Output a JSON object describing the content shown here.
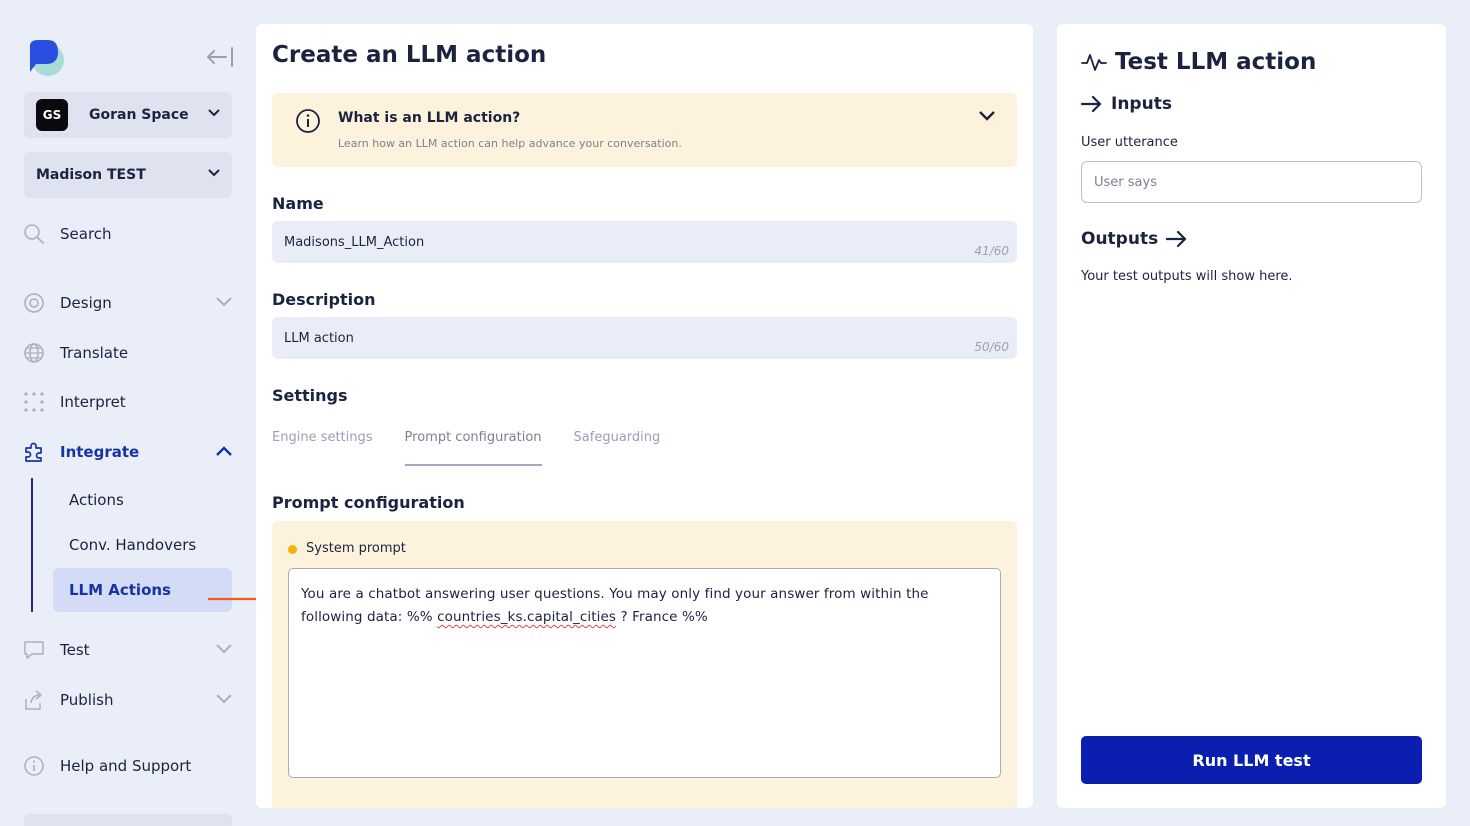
{
  "sidebar": {
    "workspace": {
      "badge": "GS",
      "name": "Goran Space"
    },
    "project": {
      "name": "Madison TEST"
    },
    "nav": {
      "search": "Search",
      "design": "Design",
      "translate": "Translate",
      "interpret": "Interpret",
      "integrate": "Integrate",
      "test": "Test",
      "publish": "Publish",
      "help": "Help and Support"
    },
    "integrate_items": [
      "Actions",
      "Conv. Handovers",
      "LLM Actions"
    ],
    "active_item": "LLM Actions"
  },
  "main": {
    "title": "Create an LLM action",
    "info": {
      "title": "What is an LLM action?",
      "subtitle": "Learn how an LLM action can help advance your conversation."
    },
    "name": {
      "label": "Name",
      "value": "Madisons_LLM_Action",
      "counter": "41/60"
    },
    "description": {
      "label": "Description",
      "value": "LLM action",
      "counter": "50/60"
    },
    "settings": {
      "label": "Settings",
      "tabs": [
        "Engine settings",
        "Prompt configuration",
        "Safeguarding"
      ],
      "active_tab": "Prompt configuration"
    },
    "prompt": {
      "heading": "Prompt configuration",
      "system_label": "System prompt",
      "text_before": "You are a chatbot answering user questions. You may only find your answer from within the following data: %% ",
      "text_flagged": "countries_ks.capital_cities",
      "text_after": " ? France %%"
    }
  },
  "test_panel": {
    "title": "Test LLM action",
    "inputs_heading": "Inputs",
    "utterance_label": "User utterance",
    "utterance_placeholder": "User says",
    "outputs_heading": "Outputs",
    "outputs_empty": "Your test outputs will show here.",
    "run_button": "Run LLM test"
  },
  "colors": {
    "background": "#eaeef8",
    "brand_blue": "#0a1fb0",
    "active_nav": "#1633a6",
    "info_bg": "#fdf3dc",
    "hint_arrow": "#f05a1a",
    "status_dot": "#f5b400"
  }
}
